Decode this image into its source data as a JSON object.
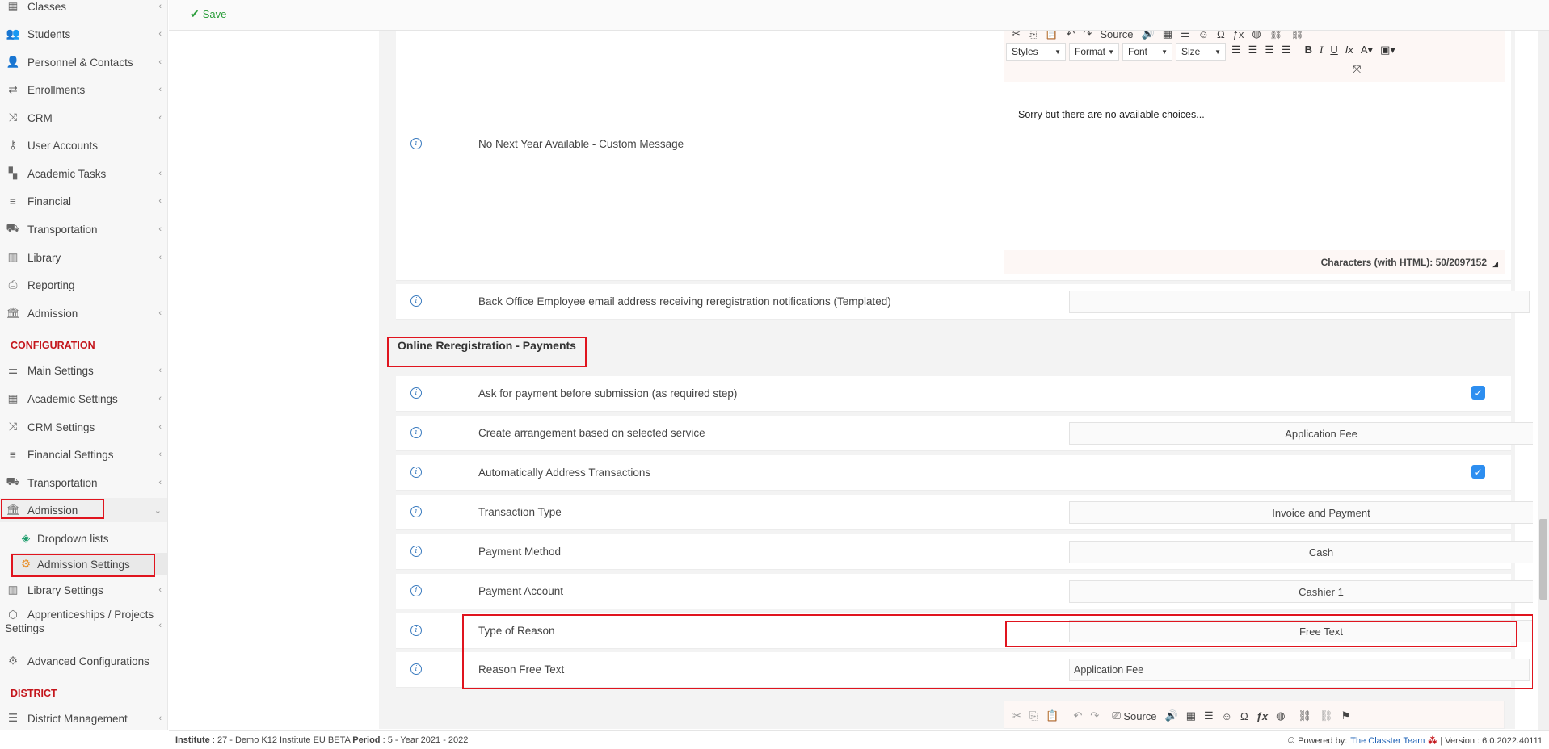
{
  "toolbar": {
    "save_label": "Save"
  },
  "sidebar": {
    "items": [
      {
        "label": "Classes",
        "icon": "classes-icon"
      },
      {
        "label": "Students",
        "icon": "students-icon"
      },
      {
        "label": "Personnel & Contacts",
        "icon": "personnel-icon"
      },
      {
        "label": "Enrollments",
        "icon": "enrollments-icon"
      },
      {
        "label": "CRM",
        "icon": "crm-icon"
      },
      {
        "label": "User Accounts",
        "icon": "key-icon"
      },
      {
        "label": "Academic Tasks",
        "icon": "tasks-icon"
      },
      {
        "label": "Financial",
        "icon": "coins-icon"
      },
      {
        "label": "Transportation",
        "icon": "bus-icon"
      },
      {
        "label": "Library",
        "icon": "books-icon"
      },
      {
        "label": "Reporting",
        "icon": "printer-icon"
      },
      {
        "label": "Admission",
        "icon": "institution-icon"
      }
    ],
    "config_header": "CONFIGURATION",
    "config_items": [
      {
        "label": "Main Settings",
        "icon": "sliders-icon"
      },
      {
        "label": "Academic Settings",
        "icon": "classes-icon"
      },
      {
        "label": "CRM Settings",
        "icon": "crm-icon"
      },
      {
        "label": "Financial Settings",
        "icon": "coins-icon"
      },
      {
        "label": "Transportation",
        "icon": "bus-icon"
      },
      {
        "label": "Admission",
        "icon": "institution-icon"
      }
    ],
    "admission_sub": [
      {
        "label": "Dropdown lists",
        "icon": "layers-icon"
      },
      {
        "label": "Admission Settings",
        "icon": "gear-icon"
      }
    ],
    "config_items_after": [
      {
        "label": "Library Settings",
        "icon": "books-icon"
      },
      {
        "label": "Apprenticeships / Projects",
        "label2": "Settings",
        "icon": "box-icon"
      },
      {
        "label": "Advanced Configurations",
        "icon": "gears-icon"
      }
    ],
    "district_header": "DISTRICT",
    "district_items": [
      {
        "label": "District Management",
        "icon": "menu-icon"
      }
    ]
  },
  "editor_top": {
    "source_label": "Source",
    "combos": [
      "Styles",
      "Format",
      "Font",
      "Size"
    ],
    "content": "Sorry but there are no available choices...",
    "char_count": "Characters (with HTML): 50/2097152"
  },
  "settings": {
    "no_next_year_label": "No Next Year Available - Custom Message",
    "back_office_label": "Back Office Employee email address receiving reregistration notifications (Templated)",
    "back_office_value": "",
    "section_title": "Online Reregistration - Payments",
    "rows": [
      {
        "label": "Ask for payment before submission (as required step)",
        "type": "checkbox",
        "checked": true
      },
      {
        "label": "Create arrangement based on selected service",
        "type": "select",
        "value": "Application Fee"
      },
      {
        "label": "Automatically Address Transactions",
        "type": "checkbox",
        "checked": true
      },
      {
        "label": "Transaction Type",
        "type": "select",
        "value": "Invoice and Payment"
      },
      {
        "label": "Payment Method",
        "type": "select",
        "value": "Cash"
      },
      {
        "label": "Payment Account",
        "type": "select",
        "value": "Cashier 1"
      },
      {
        "label": "Type of Reason",
        "type": "select",
        "value": "Free Text"
      },
      {
        "label": "Reason Free Text",
        "type": "text",
        "value": "Application Fee"
      }
    ]
  },
  "editor_bottom": {
    "source_label": "Source"
  },
  "status": {
    "institute_label": "Institute",
    "institute_value": ": 27 - Demo K12 Institute EU BETA",
    "period_label": "Period",
    "period_value": ": 5 - Year 2021 - 2022",
    "powered_by": "Powered by:",
    "team": "The Classter Team",
    "version": "| Version : 6.0.2022.40111"
  },
  "colors": {
    "accent_red": "#e0141e",
    "section_red": "#c4161c",
    "checkbox_blue": "#2d8ef0",
    "link_blue": "#1a5fb4",
    "save_green": "#2a9d3a"
  }
}
